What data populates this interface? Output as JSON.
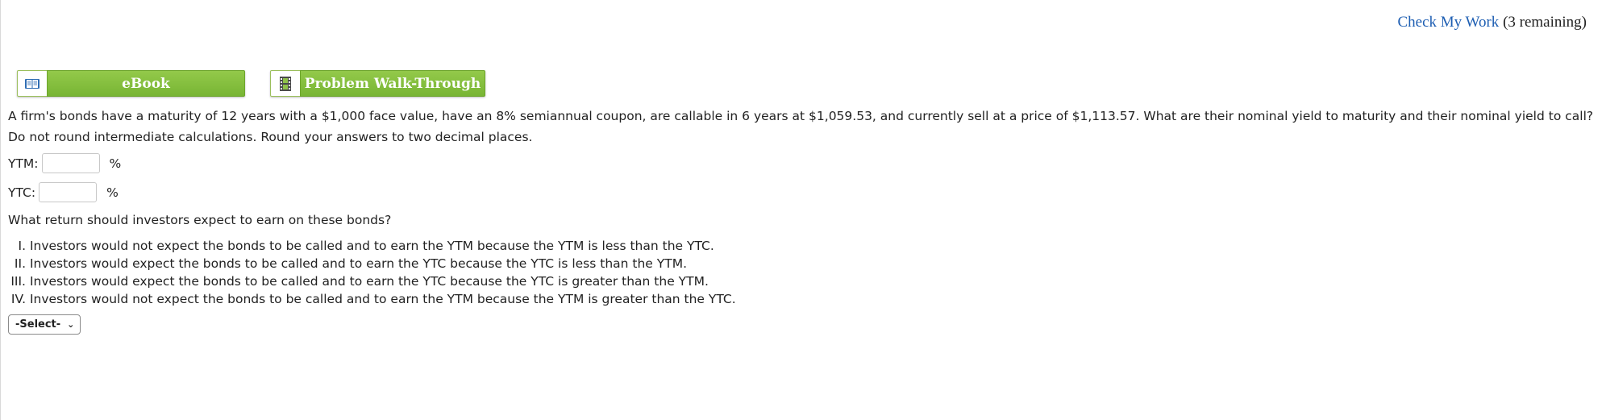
{
  "header": {
    "check_work_link": "Check My Work",
    "check_work_remaining": "(3 remaining)"
  },
  "buttons": {
    "ebook_label": "eBook",
    "walkthrough_label": "Problem Walk-Through",
    "ebook_icon": "book-icon",
    "walkthrough_icon": "film-icon"
  },
  "question": {
    "text": "A firm's bonds have a maturity of 12 years with a $1,000 face value, have an 8% semiannual coupon, are callable in 6 years at $1,059.53, and currently sell at a price of $1,113.57. What are their nominal yield to maturity and their nominal yield to call? Do not round intermediate calculations. Round your answers to two decimal places."
  },
  "fields": {
    "ytm_label": "YTM:",
    "ytm_value": "",
    "ytm_unit": "%",
    "ytc_label": "YTC:",
    "ytc_value": "",
    "ytc_unit": "%"
  },
  "followup": {
    "prompt": "What return should investors expect to earn on these bonds?",
    "options": [
      {
        "num": "I.",
        "text": "Investors would not expect the bonds to be called and to earn the YTM because the YTM is less than the YTC."
      },
      {
        "num": "II.",
        "text": "Investors would expect the bonds to be called and to earn the YTC because the YTC is less than the YTM."
      },
      {
        "num": "III.",
        "text": "Investors would expect the bonds to be called and to earn the YTC because the YTC is greater than the YTM."
      },
      {
        "num": "IV.",
        "text": "Investors would not expect the bonds to be called and to earn the YTM because the YTM is greater than the YTC."
      }
    ],
    "select_value": "-Select-"
  }
}
